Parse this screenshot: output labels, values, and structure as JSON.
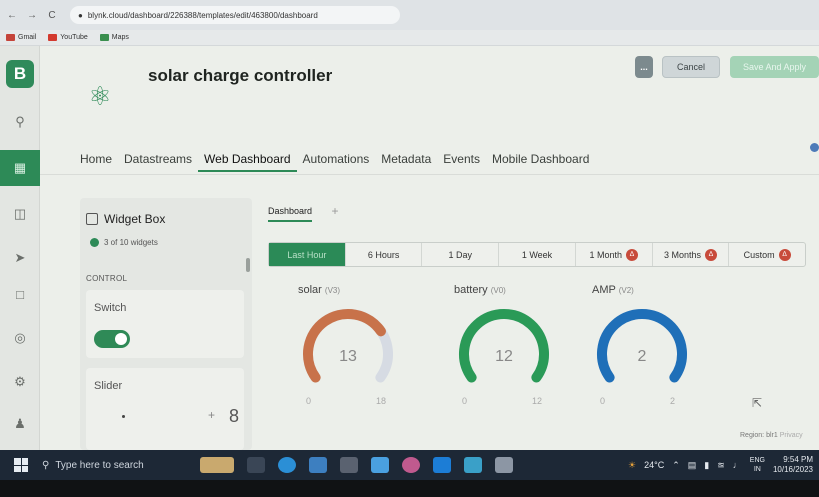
{
  "browser": {
    "back": "←",
    "forward": "→",
    "reload": "C",
    "url": "blynk.cloud/dashboard/226388/templates/edit/463800/dashboard",
    "bookmarks": [
      {
        "label": "Gmail",
        "color": "#c5443a"
      },
      {
        "label": "YouTube",
        "color": "#d33a2f"
      },
      {
        "label": "Maps",
        "color": "#3a8f4e"
      }
    ]
  },
  "sidebar": {
    "logo": "B",
    "icons": [
      "search-icon",
      "dashboard-icon",
      "devices-icon",
      "send-icon",
      "chat-icon",
      "settings-icon",
      "gear-icon",
      "user-icon"
    ]
  },
  "header": {
    "title": "solar charge controller",
    "more_label": "...",
    "cancel_label": "Cancel",
    "save_label": "Save And Apply"
  },
  "tabs": [
    {
      "label": "Home",
      "active": false
    },
    {
      "label": "Datastreams",
      "active": false
    },
    {
      "label": "Web Dashboard",
      "active": true
    },
    {
      "label": "Automations",
      "active": false
    },
    {
      "label": "Metadata",
      "active": false
    },
    {
      "label": "Events",
      "active": false
    },
    {
      "label": "Mobile Dashboard",
      "active": false
    }
  ],
  "widget_box": {
    "title": "Widget Box",
    "count": "3 of 10 widgets",
    "section": "CONTROL",
    "switch_label": "Switch",
    "switch_on": true,
    "slider_label": "Slider",
    "slider_minus": "-",
    "slider_plus": "+",
    "slider_value": "8"
  },
  "dashboard": {
    "tab": "Dashboard",
    "add": "+",
    "time_ranges": [
      {
        "label": "Last Hour",
        "active": true,
        "locked": false
      },
      {
        "label": "6 Hours",
        "active": false,
        "locked": false
      },
      {
        "label": "1 Day",
        "active": false,
        "locked": false
      },
      {
        "label": "1 Week",
        "active": false,
        "locked": false
      },
      {
        "label": "1 Month",
        "active": false,
        "locked": true
      },
      {
        "label": "3 Months",
        "active": false,
        "locked": true
      },
      {
        "label": "Custom",
        "active": false,
        "locked": true
      }
    ],
    "gauges": [
      {
        "label": "solar",
        "pin": "(V3)",
        "value": "13",
        "min": "0",
        "max": "18",
        "fraction": 0.72,
        "color": "#c8724a"
      },
      {
        "label": "battery",
        "pin": "(V0)",
        "value": "12",
        "min": "0",
        "max": "12",
        "fraction": 1.0,
        "color": "#2a9a57"
      },
      {
        "label": "AMP",
        "pin": "(V2)",
        "value": "2",
        "min": "0",
        "max": "2",
        "fraction": 1.0,
        "color": "#1f6fb8"
      }
    ],
    "region": "Region: blr1",
    "privacy": "Privacy"
  },
  "taskbar": {
    "search_placeholder": "Type here to search",
    "weather": "24°C",
    "lang_top": "ENG",
    "lang_bottom": "IN",
    "time": "9:54 PM",
    "date": "10/16/2023",
    "app_colors": [
      "#c9a96e",
      "#3a6db0",
      "#2b8fd6",
      "#3d9a6a",
      "#e0e4ea",
      "#4aa0e0",
      "#c05a8e",
      "#1c7dd6",
      "#3aa0c8",
      "#e0e4ea"
    ]
  }
}
